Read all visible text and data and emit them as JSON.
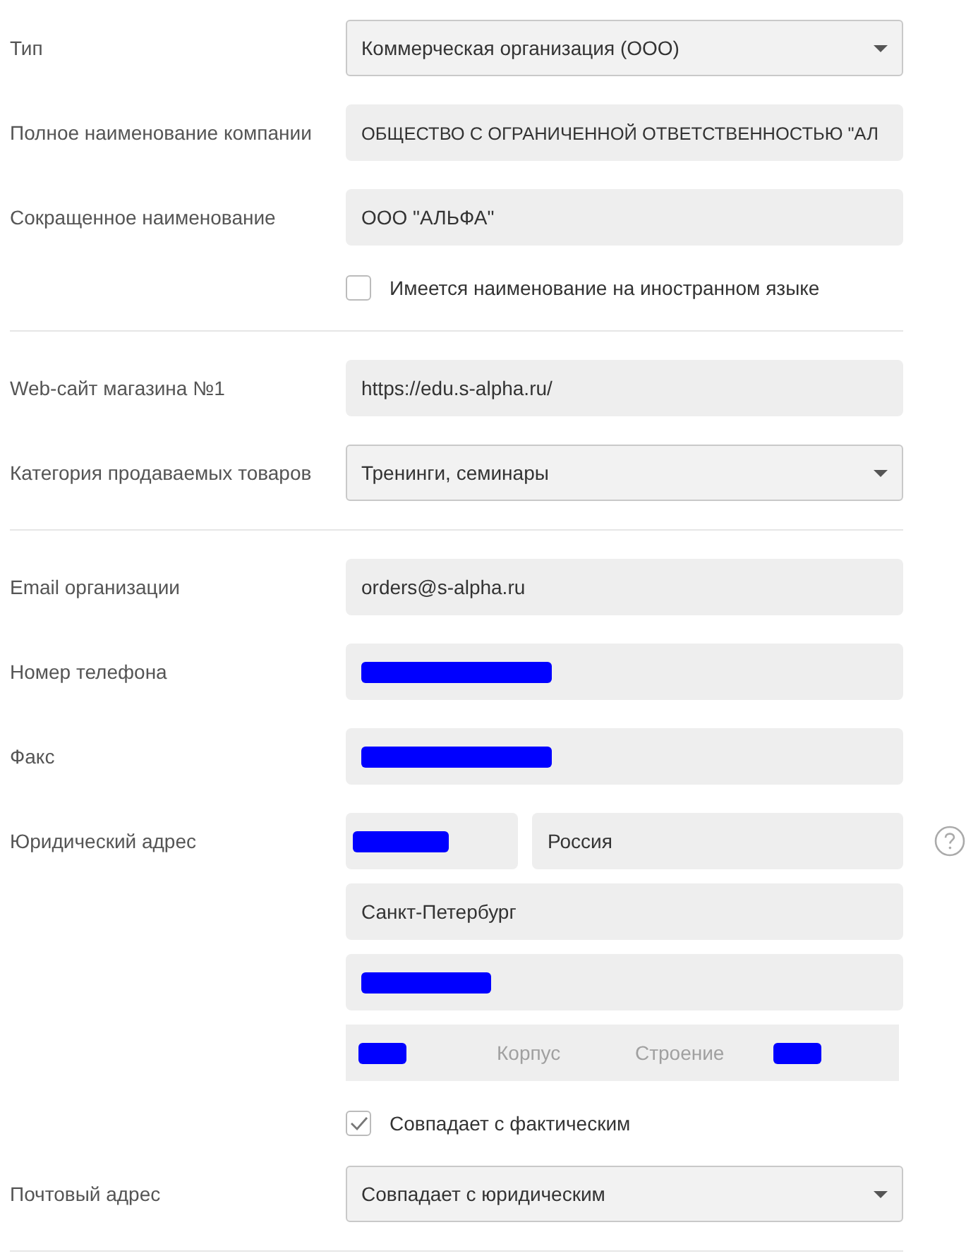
{
  "sections": [
    {
      "rows": [
        {
          "kind": "select",
          "label": "Тип",
          "value": "Коммерческая организация (ООО)"
        },
        {
          "kind": "input",
          "label": "Полное наименование компании",
          "value": "ОБЩЕСТВО С ОГРАНИЧЕННОЙ ОТВЕТСТВЕННОСТЬЮ \"АЛ",
          "redacted": false
        },
        {
          "kind": "input",
          "label": "Сокращенное наименование",
          "value": "ООО \"АЛЬФА\"",
          "redacted": false
        },
        {
          "kind": "checkbox",
          "label": "Имеется наименование на иностранном языке",
          "checked": false
        }
      ]
    },
    {
      "rows": [
        {
          "kind": "input",
          "label": "Web-сайт магазина №1",
          "value": "https://edu.s-alpha.ru/",
          "redacted": false
        },
        {
          "kind": "select",
          "label": "Категория продаваемых товаров",
          "value": "Тренинги, семинары"
        }
      ]
    },
    {
      "rows": [
        {
          "kind": "input",
          "label": "Email организации",
          "value": "orders@s-alpha.ru",
          "redacted": false
        },
        {
          "kind": "input",
          "label": "Номер телефона",
          "redacted": true
        },
        {
          "kind": "input",
          "label": "Факс",
          "redacted": true
        },
        {
          "kind": "address",
          "label": "Юридический адрес",
          "lines": [
            [
              {
                "redacted": true
              },
              {
                "value": "Россия",
                "redacted": false
              }
            ],
            [
              {
                "value": "Санкт-Петербург",
                "redacted": false
              }
            ],
            [
              {
                "redacted": true
              }
            ],
            [
              {
                "redacted": true
              },
              {
                "placeholder": "Корпус",
                "redacted": false
              },
              {
                "placeholder": "Строение",
                "redacted": false
              },
              {
                "redacted": true
              }
            ]
          ]
        },
        {
          "kind": "checkbox",
          "label": "Совпадает с фактическим",
          "checked": true
        },
        {
          "kind": "select",
          "label": "Почтовый адрес",
          "value": "Совпадает с юридическим"
        }
      ]
    }
  ]
}
